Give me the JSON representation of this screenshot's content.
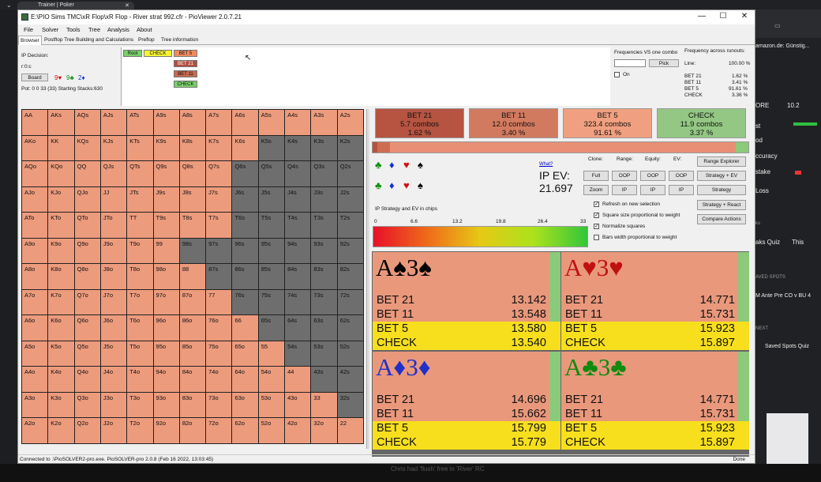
{
  "browser": {
    "tab_title": "Trainer | Poker",
    "right_items": [
      "amazon.de: Günstig...",
      "ORE",
      "10.2",
      "st",
      "od",
      "ccuracy",
      "stake",
      "Loss",
      "ks",
      "aks Quiz",
      "This",
      "AVED SPOTS",
      "M Ante Pre CO v BU 4",
      "NEXT",
      "Saved Spots Quiz"
    ],
    "bottom_text": "Chris had 'flush' free in 'River' RC"
  },
  "window": {
    "title": "E:\\PIO Sims TMC\\xR Flop\\xR Flop - River strat 992.cfr - PioViewer 2.0.7.21",
    "minimize": "—",
    "maximize": "☐",
    "close": "✕"
  },
  "menu": [
    "File",
    "Solver",
    "Tools",
    "Tree",
    "Analysis",
    "About"
  ],
  "tabs": [
    "Browser",
    "Postflop Tree Building and Calculations",
    "Preflop",
    "Tree information"
  ],
  "ip_panel": {
    "decision_label": "IP Decision:",
    "line": "r:0:c",
    "board_button": "Board",
    "board_cards": [
      {
        "text": "9♥",
        "color": "#d01010"
      },
      {
        "text": "9♣",
        "color": "#109010"
      },
      {
        "text": "2♦",
        "color": "#1030d0"
      }
    ],
    "pot": "Pot: 0 0 33 (33) Starting Stacks:630"
  },
  "tree": {
    "root": "Root",
    "check": "CHECK",
    "children": [
      "BET 5",
      "BET 21",
      "BET 11",
      "CHECK"
    ]
  },
  "freqs": {
    "vs_one_combo": "Frequencies VS one combo",
    "across_runouts": "Frequency across runouts:",
    "pick_button": "Pick",
    "on_label": "On",
    "line_label": "Line:",
    "line_value": "100.00 %",
    "rows": [
      {
        "name": "BET 21",
        "value": "1.62 %"
      },
      {
        "name": "BET 11",
        "value": "3.41 %"
      },
      {
        "name": "BET 5",
        "value": "91.61 %"
      },
      {
        "name": "CHECK",
        "value": "3.36 %"
      }
    ]
  },
  "grid": {
    "cells": [
      [
        "AA",
        "AKs",
        "AQs",
        "AJs",
        "ATs",
        "A9s",
        "A8s",
        "A7s",
        "A6s",
        "A5s",
        "A4s",
        "A3s",
        "A2s"
      ],
      [
        "AKo",
        "KK",
        "KQs",
        "KJs",
        "KTs",
        "K9s",
        "K8s",
        "K7s",
        "K6s",
        "K5s",
        "K4s",
        "K3s",
        "K2s"
      ],
      [
        "AQo",
        "KQo",
        "QQ",
        "QJs",
        "QTs",
        "Q9s",
        "Q8s",
        "Q7s",
        "Q6s",
        "Q5s",
        "Q4s",
        "Q3s",
        "Q2s"
      ],
      [
        "AJo",
        "KJo",
        "QJo",
        "JJ",
        "JTs",
        "J9s",
        "J8s",
        "J7s",
        "J6s",
        "J5s",
        "J4s",
        "J3s",
        "J2s"
      ],
      [
        "ATo",
        "KTo",
        "QTo",
        "JTo",
        "TT",
        "T9s",
        "T8s",
        "T7s",
        "T6s",
        "T5s",
        "T4s",
        "T3s",
        "T2s"
      ],
      [
        "A9o",
        "K9o",
        "Q9o",
        "J9o",
        "T9o",
        "99",
        "98s",
        "97s",
        "96s",
        "95s",
        "94s",
        "93s",
        "92s"
      ],
      [
        "A8o",
        "K8o",
        "Q8o",
        "J8o",
        "T8o",
        "98o",
        "88",
        "87s",
        "86s",
        "85s",
        "84s",
        "83s",
        "82s"
      ],
      [
        "A7o",
        "K7o",
        "Q7o",
        "J7o",
        "T7o",
        "97o",
        "87o",
        "77",
        "76s",
        "75s",
        "74s",
        "73s",
        "72s"
      ],
      [
        "A6o",
        "K6o",
        "Q6o",
        "J6o",
        "T6o",
        "96o",
        "86o",
        "76o",
        "66",
        "65s",
        "64s",
        "63s",
        "62s"
      ],
      [
        "A5o",
        "K5o",
        "Q5o",
        "J5o",
        "T5o",
        "95o",
        "85o",
        "75o",
        "65o",
        "55",
        "54s",
        "53s",
        "52s"
      ],
      [
        "A4o",
        "K4o",
        "Q4o",
        "J4o",
        "T4o",
        "94o",
        "84o",
        "74o",
        "64o",
        "54o",
        "44",
        "43s",
        "42s"
      ],
      [
        "A3o",
        "K3o",
        "Q3o",
        "J3o",
        "T3o",
        "93o",
        "83o",
        "73o",
        "63o",
        "53o",
        "43o",
        "33",
        "32s"
      ],
      [
        "A2o",
        "K2o",
        "Q2o",
        "J2o",
        "T2o",
        "92o",
        "82o",
        "72o",
        "62o",
        "52o",
        "42o",
        "32o",
        "22"
      ]
    ],
    "colors": {
      "active": "#ed9b7d",
      "inactive": "#6e6e6e",
      "border": "#222222"
    },
    "active_count_per_row": [
      13,
      9,
      8,
      8,
      8,
      6,
      7,
      8,
      9,
      10,
      11,
      12,
      13
    ]
  },
  "actions": [
    {
      "name": "BET 21",
      "combos": "5.7 combos",
      "pct": "1.62 %",
      "color": "#b65441"
    },
    {
      "name": "BET 11",
      "combos": "12.0 combos",
      "pct": "3.40 %",
      "color": "#d27a5f"
    },
    {
      "name": "BET 5",
      "combos": "323.4 combos",
      "pct": "91.61 %",
      "color": "#f0a080"
    },
    {
      "name": "CHECK",
      "combos": "11.9 combos",
      "pct": "3.37 %",
      "color": "#93c783"
    }
  ],
  "suits_row1": [
    {
      "s": "♣",
      "c": "#109010"
    },
    {
      "s": "♦",
      "c": "#1030d0"
    },
    {
      "s": "♥",
      "c": "#d01010"
    },
    {
      "s": "♠",
      "c": "#000000"
    }
  ],
  "suits_row2": [
    {
      "s": "♣",
      "c": "#109010"
    },
    {
      "s": "♦",
      "c": "#1030d0"
    },
    {
      "s": "♥",
      "c": "#d01010"
    },
    {
      "s": "♠",
      "c": "#000000"
    }
  ],
  "ev": {
    "what_link": "What?",
    "label": "IP EV:",
    "value": "21.697"
  },
  "controls": {
    "labels": [
      "Clone:",
      "Range:",
      "Equity:",
      "EV:"
    ],
    "full": "Full",
    "zoom": "Zoom",
    "oop": "OOP",
    "ip": "IP",
    "range_explorer": "Range Explorer",
    "strategy_ev": "Strategy + EV",
    "strategy": "Strategy",
    "strategy_react": "Strategy + React",
    "compare_actions": "Compare Actions",
    "checkboxes": [
      {
        "label": "Refresh on new selection",
        "checked": true
      },
      {
        "label": "Square size proportional to weight",
        "checked": true
      },
      {
        "label": "Normalize squares",
        "checked": true
      },
      {
        "label": "Bars width proportional to weight",
        "checked": false
      }
    ]
  },
  "gradient": {
    "label": "IP Strategy and EV in chips",
    "ticks": [
      "0",
      "6.6",
      "13.2",
      "19.8",
      "26.4",
      "33"
    ]
  },
  "combos": [
    {
      "title": "A♠3♠",
      "color": "#000000",
      "rows": [
        [
          "BET 21",
          "13.142"
        ],
        [
          "BET 11",
          "13.548"
        ],
        [
          "BET 5",
          "13.580"
        ],
        [
          "CHECK",
          "13.540"
        ]
      ]
    },
    {
      "title": "A♥3♥",
      "color": "#c01010",
      "rows": [
        [
          "BET 21",
          "14.771"
        ],
        [
          "BET 11",
          "15.731"
        ],
        [
          "BET 5",
          "15.923"
        ],
        [
          "CHECK",
          "15.897"
        ]
      ]
    },
    {
      "title": "A♦3♦",
      "color": "#2030c8",
      "rows": [
        [
          "BET 21",
          "14.696"
        ],
        [
          "BET 11",
          "15.662"
        ],
        [
          "BET 5",
          "15.799"
        ],
        [
          "CHECK",
          "15.779"
        ]
      ]
    },
    {
      "title": "A♣3♣",
      "color": "#108a10",
      "rows": [
        [
          "BET 21",
          "14.771"
        ],
        [
          "BET 11",
          "15.731"
        ],
        [
          "BET 5",
          "15.923"
        ],
        [
          "CHECK",
          "15.897"
        ]
      ]
    }
  ],
  "combo_row_colors": {
    "bet": "#e9987c",
    "highlight": "#f7df1e"
  },
  "status": {
    "text": "Connected to .\\PioSOLVER2-pro.exe. PioSOLVER-pro 2.0.8 (Feb 16 2022, 13:03:45)",
    "done": "Done"
  }
}
